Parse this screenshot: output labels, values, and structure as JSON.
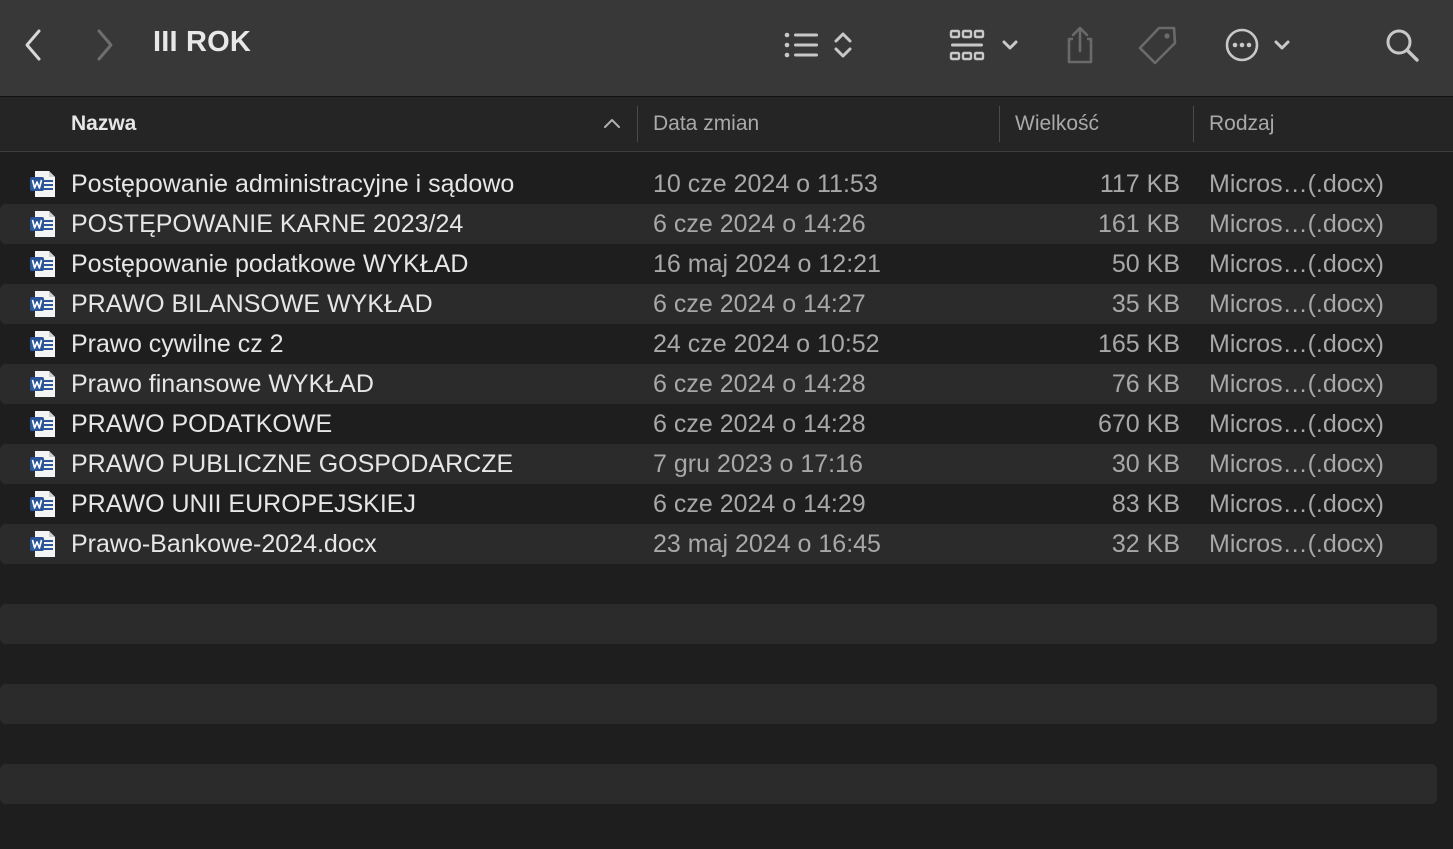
{
  "window": {
    "title": "III ROK"
  },
  "toolbar": {
    "back_icon": "chevron-left-icon",
    "forward_icon": "chevron-right-icon",
    "view_list_icon": "list-view-icon",
    "view_gallery_icon": "icon-grid-icon",
    "share_icon": "share-icon",
    "tag_icon": "tag-icon",
    "more_icon": "ellipsis-circle-icon",
    "search_icon": "search-icon"
  },
  "columns": {
    "name": "Nazwa",
    "date": "Data zmian",
    "size": "Wielkość",
    "kind": "Rodzaj"
  },
  "files": [
    {
      "name": "Postępowanie administracyjne i sądowo",
      "date": "10 cze 2024 o 11:53",
      "size": "117 KB",
      "kind": "Micros…(.docx)"
    },
    {
      "name": "POSTĘPOWANIE KARNE 2023/24",
      "date": "6 cze 2024 o 14:26",
      "size": "161 KB",
      "kind": "Micros…(.docx)"
    },
    {
      "name": "Postępowanie podatkowe WYKŁAD",
      "date": "16 maj 2024 o 12:21",
      "size": "50 KB",
      "kind": "Micros…(.docx)"
    },
    {
      "name": "PRAWO BILANSOWE WYKŁAD",
      "date": "6 cze 2024 o 14:27",
      "size": "35 KB",
      "kind": "Micros…(.docx)"
    },
    {
      "name": "Prawo cywilne cz 2",
      "date": "24 cze 2024 o 10:52",
      "size": "165 KB",
      "kind": "Micros…(.docx)"
    },
    {
      "name": "Prawo finansowe WYKŁAD",
      "date": "6 cze 2024 o 14:28",
      "size": "76 KB",
      "kind": "Micros…(.docx)"
    },
    {
      "name": "PRAWO PODATKOWE",
      "date": "6 cze 2024 o 14:28",
      "size": "670 KB",
      "kind": "Micros…(.docx)"
    },
    {
      "name": "PRAWO PUBLICZNE GOSPODARCZE",
      "date": "7 gru 2023 o 17:16",
      "size": "30 KB",
      "kind": "Micros…(.docx)"
    },
    {
      "name": "PRAWO UNII EUROPEJSKIEJ",
      "date": "6 cze 2024 o 14:29",
      "size": "83 KB",
      "kind": "Micros…(.docx)"
    },
    {
      "name": "Prawo-Bankowe-2024.docx",
      "date": "23 maj 2024 o 16:45",
      "size": "32 KB",
      "kind": "Micros…(.docx)"
    }
  ],
  "colors": {
    "toolbar_bg": "#383838",
    "window_bg": "#1e1e1e",
    "alt_row_bg": "#2b2b2b",
    "word_icon_blue": "#2b579a"
  }
}
